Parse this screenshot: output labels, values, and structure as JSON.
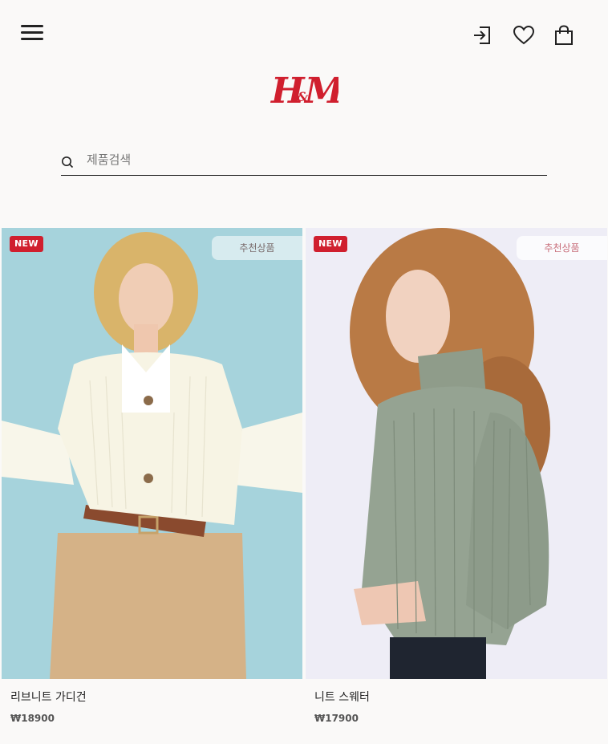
{
  "brand": {
    "logo_text": "H&M",
    "logo_color": "#d01f2e"
  },
  "header": {
    "menu_icon": "hamburger-menu-icon",
    "icons": [
      "login-icon",
      "heart-icon",
      "shopping-bag-icon"
    ]
  },
  "search": {
    "placeholder": "제품검색",
    "value": "",
    "icon": "search-icon"
  },
  "products": [
    {
      "badge_new": "NEW",
      "badge_recommended": "추천상품",
      "name": "리브니트 가디건",
      "price": "₩18900",
      "image": "model in cream ribbed cardigan with beige trousers"
    },
    {
      "badge_new": "NEW",
      "badge_recommended": "추천상품",
      "name": "니트 스웨터",
      "price": "₩17900",
      "image": "model in sage green chunky knit sweater"
    }
  ],
  "colors": {
    "accent": "#d01f2e",
    "background": "#faf9f8"
  }
}
